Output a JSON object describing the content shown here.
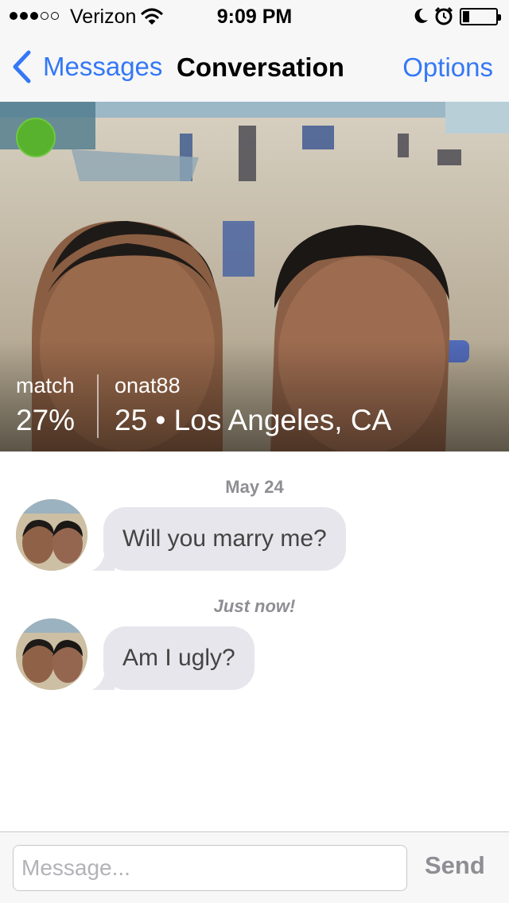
{
  "status_bar": {
    "carrier": "Verizon",
    "time": "9:09 PM",
    "signal_bars_filled": 3,
    "signal_bars_total": 5,
    "icons": [
      "wifi-icon",
      "moon-icon",
      "alarm-icon",
      "battery-icon"
    ],
    "battery_level": 0.15
  },
  "nav": {
    "back_label": "Messages",
    "title": "Conversation",
    "options_label": "Options",
    "accent_color": "#3478f6"
  },
  "profile": {
    "online_color": "#58b22e",
    "match_label": "match",
    "match_value": "27%",
    "username": "onat88",
    "age_location": "25 • Los Angeles, CA"
  },
  "conversation": {
    "groups": [
      {
        "date_label": "May 24",
        "message": "Will you marry me?"
      },
      {
        "date_label": "Just now!",
        "message": "Am I ugly?"
      }
    ]
  },
  "composer": {
    "placeholder": "Message...",
    "send_label": "Send"
  }
}
